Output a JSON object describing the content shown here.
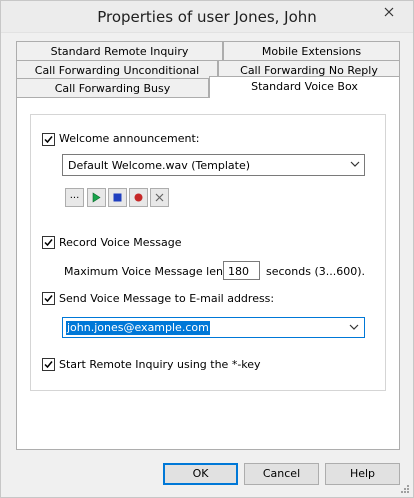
{
  "window": {
    "title": "Properties of user Jones, John"
  },
  "tabs": {
    "row1": [
      "Standard Remote Inquiry",
      "Mobile Extensions"
    ],
    "row2": [
      "Call Forwarding Unconditional",
      "Call Forwarding No Reply"
    ],
    "row3": [
      "Call Forwarding Busy",
      "Standard Voice Box"
    ],
    "active": "Standard Voice Box"
  },
  "voicebox": {
    "welcome_label": "Welcome announcement:",
    "welcome_checked": true,
    "welcome_file": "Default Welcome.wav (Template)",
    "browse_label": "...",
    "record_label": "Record Voice Message",
    "record_checked": true,
    "max_length_label": "Maximum Voice Message length",
    "max_length_value": "180",
    "max_length_hint": "seconds (3...600).",
    "email_label": "Send Voice Message to E-mail address:",
    "email_checked": true,
    "email_value": "john.jones@example.com",
    "remote_label": "Start Remote Inquiry using the *-key",
    "remote_checked": true
  },
  "buttons": {
    "ok": "OK",
    "cancel": "Cancel",
    "help": "Help"
  },
  "colors": {
    "accent": "#0078d7",
    "play": "#16a34a",
    "stop": "#1f3fbf",
    "record": "#c62828"
  }
}
